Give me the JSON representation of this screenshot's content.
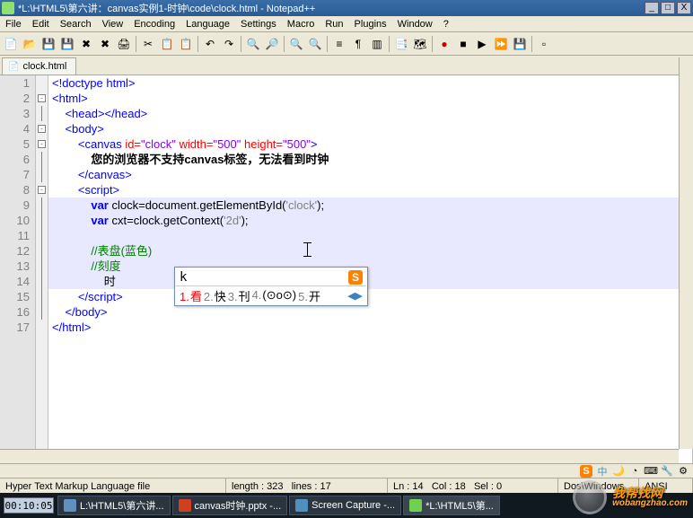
{
  "title": "*L:\\HTML5\\第六讲：canvas实例1-时钟\\code\\clock.html - Notepad++",
  "win_btns": {
    "min": "_",
    "max": "□",
    "close": "X"
  },
  "menus": [
    "File",
    "Edit",
    "Search",
    "View",
    "Encoding",
    "Language",
    "Settings",
    "Macro",
    "Run",
    "Plugins",
    "Window",
    "?"
  ],
  "tab": {
    "label": "clock.html"
  },
  "line_numbers": [
    "1",
    "2",
    "3",
    "4",
    "5",
    "6",
    "7",
    "8",
    "9",
    "10",
    "11",
    "12",
    "13",
    "14",
    "15",
    "16",
    "17"
  ],
  "code": {
    "l1_tag": "<!doctype html>",
    "l2_tag_open": "<",
    "l2_tag_name": "html",
    "l2_tag_close": ">",
    "l3_head": "<head></head>",
    "l4_body_open": "<body>",
    "l5_canvas_open": "<canvas",
    "l5_attr_id": " id=",
    "l5_val_id": "\"clock\"",
    "l5_attr_w": " width=",
    "l5_val_w": "\"500\"",
    "l5_attr_h": " height=",
    "l5_val_h": "\"500\"",
    "l5_end": ">",
    "l6_text": "您的浏览器不支持canvas标签，无法看到时钟",
    "l7_canvas_close": "</canvas>",
    "l8_script_open": "<script>",
    "l9": "var clock=document.getElementById('clock');",
    "l10": "var cxt=clock.getContext('2d');",
    "l12_comment": "//表盘(蓝色)",
    "l13_comment": "//刻度",
    "l14_text": "时",
    "l15_script_close": "</script>",
    "l16_body_close": "</body>",
    "l17_html_close": "</html>"
  },
  "ime": {
    "typed": "k",
    "brand": "S",
    "candidates": [
      {
        "num": "1.",
        "txt": "看"
      },
      {
        "num": "2.",
        "txt": "快"
      },
      {
        "num": "3.",
        "txt": "刊"
      },
      {
        "num": "4.",
        "txt": "(⊙o⊙)"
      },
      {
        "num": "5.",
        "txt": "开"
      }
    ],
    "nav": "◀▶"
  },
  "status": {
    "filetype": "Hyper Text Markup Language file",
    "length_label": "length :",
    "length_val": "323",
    "lines_label": "lines :",
    "lines_val": "17",
    "ln_label": "Ln :",
    "ln_val": "14",
    "col_label": "Col :",
    "col_val": "18",
    "sel_label": "Sel :",
    "sel_val": "0",
    "eol": "Dos\\Windows",
    "enc": "ANSI"
  },
  "tray": {
    "ime_indicator": "中",
    "moon": "🌙",
    "shape": "◔"
  },
  "taskbar": {
    "timer": "00:10:05",
    "items": [
      {
        "label": "L:\\HTML5\\第六讲..."
      },
      {
        "label": "canvas时钟.pptx -..."
      },
      {
        "label": "Screen Capture -..."
      },
      {
        "label": "*L:\\HTML5\\第..."
      }
    ]
  },
  "watermark": {
    "cn": "我帮找网",
    "url": "wobangzhao.com"
  }
}
